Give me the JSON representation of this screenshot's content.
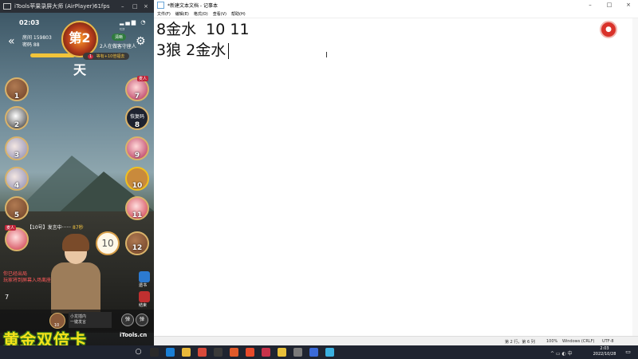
{
  "phone_window": {
    "title": "iTools苹果录屏大师 (AirPlayer)",
    "fps": "61fps",
    "window_controls": [
      "–",
      "□",
      "×"
    ],
    "status_time": "02:03",
    "status_icons": "▂▄▆ ◔ ▭",
    "back_icon": "«",
    "room_line1": "房间 159803",
    "room_line2": "密码 88",
    "emblem_text": "第2天",
    "right_badge": "清晰",
    "right_info": "2人在做客守座人",
    "gear_icon": "⚙",
    "round_badge": "1",
    "round_pill": "等有+10倍福去",
    "seats_left": [
      "1",
      "2",
      "3",
      "4",
      "5"
    ],
    "seats_right": [
      "7",
      "8",
      "9",
      "10",
      "11",
      "12"
    ],
    "seat8_label": "恢复码",
    "tag_labels": [
      "麦人",
      "麦人"
    ],
    "speaking_text": "【10号】发言中······",
    "speaking_time": "87秒",
    "bubble_number": "10",
    "left_red_text": "你已经出局\n玩家将到屏幕入场离座",
    "left_small_number": "7",
    "right_icon_labels": [
      "遗书",
      "结束"
    ],
    "bottom_avatar_number": "10",
    "bottom_card_line1": "小龙插内",
    "bottom_card_line2": "一键发言",
    "bottom_buttons": [
      "弹",
      "弹"
    ],
    "gold_text": "黄金双倍卡",
    "watermark": "iTools.cn"
  },
  "notepad": {
    "title": "*新建文本文档 - 记事本",
    "window_controls": [
      "–",
      "□",
      "×"
    ],
    "menu": [
      "文件(F)",
      "编辑(E)",
      "格式(O)",
      "查看(V)",
      "帮助(H)"
    ],
    "line1": "8金水  10 11",
    "line2": "3狼 2金水",
    "record_icon": "record-icon",
    "status": {
      "position": "第 2 行，第 6 列",
      "zoom": "100%",
      "eol": "Windows (CRLF)",
      "encoding": "UTF-8"
    }
  },
  "taskbar": {
    "clock_time": "2:03",
    "clock_date": "2022/10/28",
    "tray_text": "^ ▭ ◐ 中"
  },
  "colors": {
    "taskbar_bg": "#1f2430",
    "gold_text": "#f5e21a",
    "record_red": "#d9322a"
  }
}
